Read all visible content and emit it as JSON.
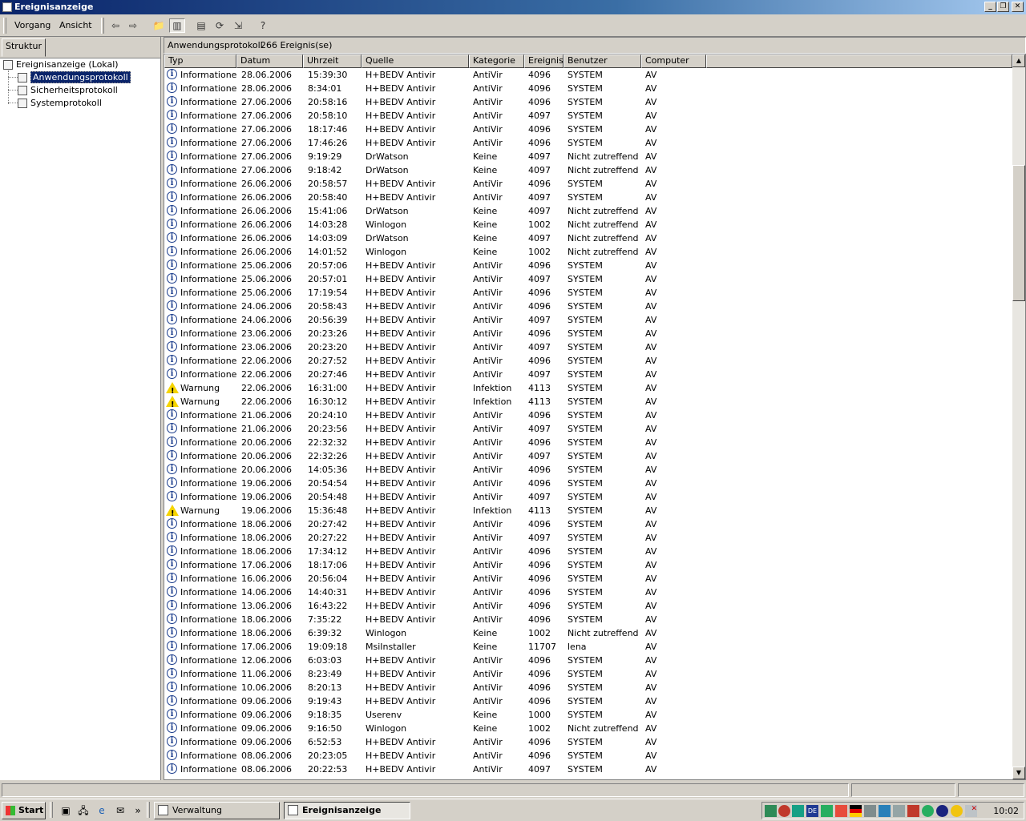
{
  "window": {
    "title": "Ereignisanzeige"
  },
  "menu": {
    "items": [
      "Vorgang",
      "Ansicht"
    ]
  },
  "toolbar": {
    "icons": [
      "back-arrow-icon",
      "forward-arrow-icon",
      "up-folder-icon",
      "show-hide-tree-icon",
      "properties-icon",
      "refresh-icon",
      "export-list-icon",
      "help-icon"
    ]
  },
  "tree": {
    "tab_label": "Struktur",
    "root": "Ereignisanzeige (Lokal)",
    "items": [
      "Anwendungsprotokoll",
      "Sicherheitsprotokoll",
      "Systemprotokoll"
    ]
  },
  "detail": {
    "log_name": "Anwendungsprotokoll",
    "count": "266 Ereignis(se)"
  },
  "columns": [
    "Typ",
    "Datum",
    "Uhrzeit",
    "Quelle",
    "Kategorie",
    "Ereignis",
    "Benutzer",
    "Computer"
  ],
  "rows": [
    [
      "Informationen",
      "28.06.2006",
      "15:39:30",
      "H+BEDV Antivir",
      "AntiVir",
      "4096",
      "SYSTEM",
      "AV"
    ],
    [
      "Informationen",
      "28.06.2006",
      "8:34:01",
      "H+BEDV Antivir",
      "AntiVir",
      "4096",
      "SYSTEM",
      "AV"
    ],
    [
      "Informationen",
      "27.06.2006",
      "20:58:16",
      "H+BEDV Antivir",
      "AntiVir",
      "4096",
      "SYSTEM",
      "AV"
    ],
    [
      "Informationen",
      "27.06.2006",
      "20:58:10",
      "H+BEDV Antivir",
      "AntiVir",
      "4097",
      "SYSTEM",
      "AV"
    ],
    [
      "Informationen",
      "27.06.2006",
      "18:17:46",
      "H+BEDV Antivir",
      "AntiVir",
      "4096",
      "SYSTEM",
      "AV"
    ],
    [
      "Informationen",
      "27.06.2006",
      "17:46:26",
      "H+BEDV Antivir",
      "AntiVir",
      "4096",
      "SYSTEM",
      "AV"
    ],
    [
      "Informationen",
      "27.06.2006",
      "9:19:29",
      "DrWatson",
      "Keine",
      "4097",
      "Nicht zutreffend",
      "AV"
    ],
    [
      "Informationen",
      "27.06.2006",
      "9:18:42",
      "DrWatson",
      "Keine",
      "4097",
      "Nicht zutreffend",
      "AV"
    ],
    [
      "Informationen",
      "26.06.2006",
      "20:58:57",
      "H+BEDV Antivir",
      "AntiVir",
      "4096",
      "SYSTEM",
      "AV"
    ],
    [
      "Informationen",
      "26.06.2006",
      "20:58:40",
      "H+BEDV Antivir",
      "AntiVir",
      "4097",
      "SYSTEM",
      "AV"
    ],
    [
      "Informationen",
      "26.06.2006",
      "15:41:06",
      "DrWatson",
      "Keine",
      "4097",
      "Nicht zutreffend",
      "AV"
    ],
    [
      "Informationen",
      "26.06.2006",
      "14:03:28",
      "Winlogon",
      "Keine",
      "1002",
      "Nicht zutreffend",
      "AV"
    ],
    [
      "Informationen",
      "26.06.2006",
      "14:03:09",
      "DrWatson",
      "Keine",
      "4097",
      "Nicht zutreffend",
      "AV"
    ],
    [
      "Informationen",
      "26.06.2006",
      "14:01:52",
      "Winlogon",
      "Keine",
      "1002",
      "Nicht zutreffend",
      "AV"
    ],
    [
      "Informationen",
      "25.06.2006",
      "20:57:06",
      "H+BEDV Antivir",
      "AntiVir",
      "4096",
      "SYSTEM",
      "AV"
    ],
    [
      "Informationen",
      "25.06.2006",
      "20:57:01",
      "H+BEDV Antivir",
      "AntiVir",
      "4097",
      "SYSTEM",
      "AV"
    ],
    [
      "Informationen",
      "25.06.2006",
      "17:19:54",
      "H+BEDV Antivir",
      "AntiVir",
      "4096",
      "SYSTEM",
      "AV"
    ],
    [
      "Informationen",
      "24.06.2006",
      "20:58:43",
      "H+BEDV Antivir",
      "AntiVir",
      "4096",
      "SYSTEM",
      "AV"
    ],
    [
      "Informationen",
      "24.06.2006",
      "20:56:39",
      "H+BEDV Antivir",
      "AntiVir",
      "4097",
      "SYSTEM",
      "AV"
    ],
    [
      "Informationen",
      "23.06.2006",
      "20:23:26",
      "H+BEDV Antivir",
      "AntiVir",
      "4096",
      "SYSTEM",
      "AV"
    ],
    [
      "Informationen",
      "23.06.2006",
      "20:23:20",
      "H+BEDV Antivir",
      "AntiVir",
      "4097",
      "SYSTEM",
      "AV"
    ],
    [
      "Informationen",
      "22.06.2006",
      "20:27:52",
      "H+BEDV Antivir",
      "AntiVir",
      "4096",
      "SYSTEM",
      "AV"
    ],
    [
      "Informationen",
      "22.06.2006",
      "20:27:46",
      "H+BEDV Antivir",
      "AntiVir",
      "4097",
      "SYSTEM",
      "AV"
    ],
    [
      "Warnung",
      "22.06.2006",
      "16:31:00",
      "H+BEDV Antivir",
      "Infektion",
      "4113",
      "SYSTEM",
      "AV"
    ],
    [
      "Warnung",
      "22.06.2006",
      "16:30:12",
      "H+BEDV Antivir",
      "Infektion",
      "4113",
      "SYSTEM",
      "AV"
    ],
    [
      "Informationen",
      "21.06.2006",
      "20:24:10",
      "H+BEDV Antivir",
      "AntiVir",
      "4096",
      "SYSTEM",
      "AV"
    ],
    [
      "Informationen",
      "21.06.2006",
      "20:23:56",
      "H+BEDV Antivir",
      "AntiVir",
      "4097",
      "SYSTEM",
      "AV"
    ],
    [
      "Informationen",
      "20.06.2006",
      "22:32:32",
      "H+BEDV Antivir",
      "AntiVir",
      "4096",
      "SYSTEM",
      "AV"
    ],
    [
      "Informationen",
      "20.06.2006",
      "22:32:26",
      "H+BEDV Antivir",
      "AntiVir",
      "4097",
      "SYSTEM",
      "AV"
    ],
    [
      "Informationen",
      "20.06.2006",
      "14:05:36",
      "H+BEDV Antivir",
      "AntiVir",
      "4096",
      "SYSTEM",
      "AV"
    ],
    [
      "Informationen",
      "19.06.2006",
      "20:54:54",
      "H+BEDV Antivir",
      "AntiVir",
      "4096",
      "SYSTEM",
      "AV"
    ],
    [
      "Informationen",
      "19.06.2006",
      "20:54:48",
      "H+BEDV Antivir",
      "AntiVir",
      "4097",
      "SYSTEM",
      "AV"
    ],
    [
      "Warnung",
      "19.06.2006",
      "15:36:48",
      "H+BEDV Antivir",
      "Infektion",
      "4113",
      "SYSTEM",
      "AV"
    ],
    [
      "Informationen",
      "18.06.2006",
      "20:27:42",
      "H+BEDV Antivir",
      "AntiVir",
      "4096",
      "SYSTEM",
      "AV"
    ],
    [
      "Informationen",
      "18.06.2006",
      "20:27:22",
      "H+BEDV Antivir",
      "AntiVir",
      "4097",
      "SYSTEM",
      "AV"
    ],
    [
      "Informationen",
      "18.06.2006",
      "17:34:12",
      "H+BEDV Antivir",
      "AntiVir",
      "4096",
      "SYSTEM",
      "AV"
    ],
    [
      "Informationen",
      "17.06.2006",
      "18:17:06",
      "H+BEDV Antivir",
      "AntiVir",
      "4096",
      "SYSTEM",
      "AV"
    ],
    [
      "Informationen",
      "16.06.2006",
      "20:56:04",
      "H+BEDV Antivir",
      "AntiVir",
      "4096",
      "SYSTEM",
      "AV"
    ],
    [
      "Informationen",
      "14.06.2006",
      "14:40:31",
      "H+BEDV Antivir",
      "AntiVir",
      "4096",
      "SYSTEM",
      "AV"
    ],
    [
      "Informationen",
      "13.06.2006",
      "16:43:22",
      "H+BEDV Antivir",
      "AntiVir",
      "4096",
      "SYSTEM",
      "AV"
    ],
    [
      "Informationen",
      "18.06.2006",
      "7:35:22",
      "H+BEDV Antivir",
      "AntiVir",
      "4096",
      "SYSTEM",
      "AV"
    ],
    [
      "Informationen",
      "18.06.2006",
      "6:39:32",
      "Winlogon",
      "Keine",
      "1002",
      "Nicht zutreffend",
      "AV"
    ],
    [
      "Informationen",
      "17.06.2006",
      "19:09:18",
      "MsiInstaller",
      "Keine",
      "11707",
      "lena",
      "AV"
    ],
    [
      "Informationen",
      "12.06.2006",
      "6:03:03",
      "H+BEDV Antivir",
      "AntiVir",
      "4096",
      "SYSTEM",
      "AV"
    ],
    [
      "Informationen",
      "11.06.2006",
      "8:23:49",
      "H+BEDV Antivir",
      "AntiVir",
      "4096",
      "SYSTEM",
      "AV"
    ],
    [
      "Informationen",
      "10.06.2006",
      "8:20:13",
      "H+BEDV Antivir",
      "AntiVir",
      "4096",
      "SYSTEM",
      "AV"
    ],
    [
      "Informationen",
      "09.06.2006",
      "9:19:43",
      "H+BEDV Antivir",
      "AntiVir",
      "4096",
      "SYSTEM",
      "AV"
    ],
    [
      "Informationen",
      "09.06.2006",
      "9:18:35",
      "Userenv",
      "Keine",
      "1000",
      "SYSTEM",
      "AV"
    ],
    [
      "Informationen",
      "09.06.2006",
      "9:16:50",
      "Winlogon",
      "Keine",
      "1002",
      "Nicht zutreffend",
      "AV"
    ],
    [
      "Informationen",
      "09.06.2006",
      "6:52:53",
      "H+BEDV Antivir",
      "AntiVir",
      "4096",
      "SYSTEM",
      "AV"
    ],
    [
      "Informationen",
      "08.06.2006",
      "20:23:05",
      "H+BEDV Antivir",
      "AntiVir",
      "4096",
      "SYSTEM",
      "AV"
    ],
    [
      "Informationen",
      "08.06.2006",
      "20:22:53",
      "H+BEDV Antivir",
      "AntiVir",
      "4097",
      "SYSTEM",
      "AV"
    ]
  ],
  "taskbar": {
    "start_label": "Start",
    "quicklaunch_icons": [
      "show-desktop-icon",
      "network-icon",
      "internet-explorer-icon",
      "outlook-icon"
    ],
    "overflow": "»",
    "tasks": [
      "Verwaltung",
      "Ereignisanzeige"
    ],
    "tray_language": "DE",
    "clock": "10:02"
  }
}
